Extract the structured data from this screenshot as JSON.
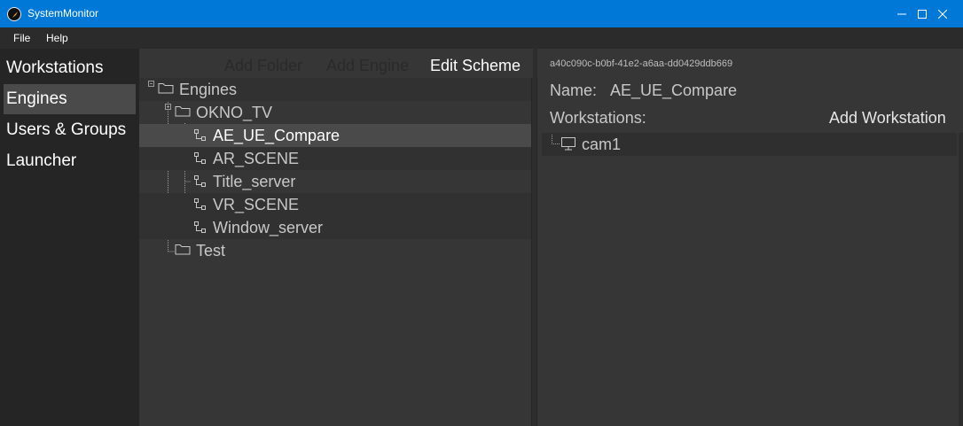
{
  "window": {
    "title": "SystemMonitor"
  },
  "menu": {
    "items": [
      "File",
      "Help"
    ]
  },
  "nav": {
    "items": [
      "Workstations",
      "Engines",
      "Users & Groups",
      "Launcher"
    ],
    "active": "Engines"
  },
  "toolbar": {
    "add_folder": "Add Folder",
    "add_engine": "Add Engine",
    "edit_scheme": "Edit Scheme"
  },
  "tree": {
    "root": "Engines",
    "folder1": "OKNO_TV",
    "engines": [
      "AE_UE_Compare",
      "AR_SCENE",
      "Title_server",
      "VR_SCENE",
      "Window_server"
    ],
    "selected": "AE_UE_Compare",
    "folder2": "Test"
  },
  "details": {
    "guid": "a40c090c-b0bf-41e2-a6aa-dd0429ddb669",
    "name_label": "Name:",
    "name_value": "AE_UE_Compare",
    "workstations_label": "Workstations:",
    "add_workstation": "Add Workstation",
    "workstations": [
      "cam1"
    ]
  },
  "colors": {
    "titlebar": "#0078d7",
    "background": "#2d2d2d",
    "pane": "#363636",
    "selected": "#4a4a4a"
  },
  "icons": {
    "folder": "folder-icon",
    "engine": "engine-node-icon",
    "workstation": "monitor-icon"
  }
}
